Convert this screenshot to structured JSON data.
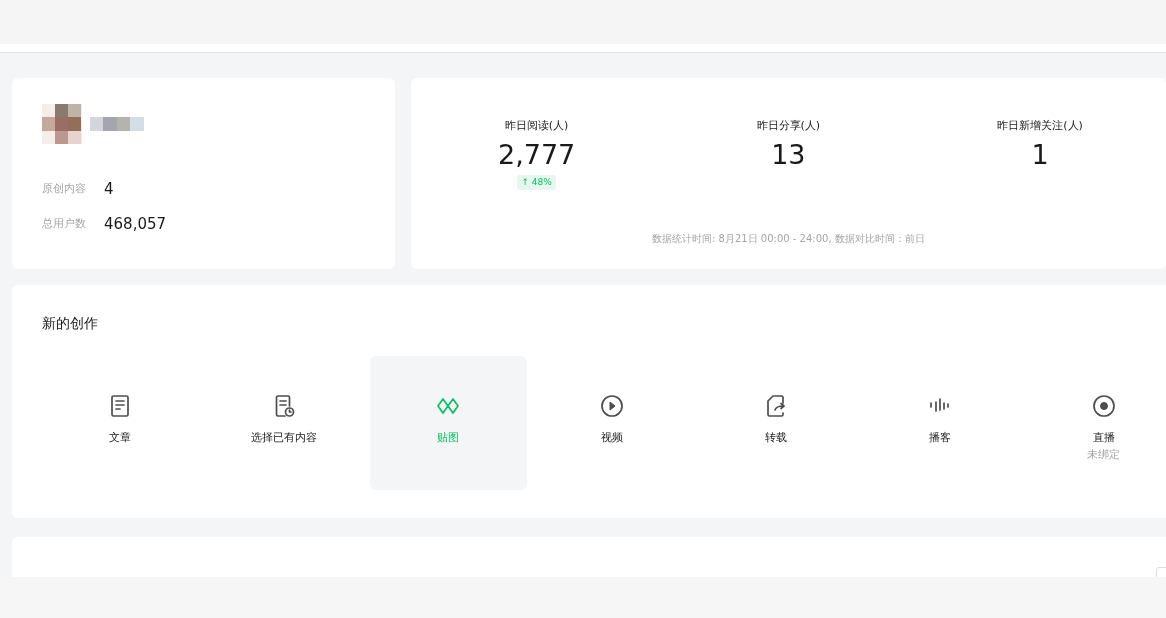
{
  "profile": {
    "stats": [
      {
        "label": "原创内容",
        "value": "4"
      },
      {
        "label": "总用户数",
        "value": "468,057"
      }
    ]
  },
  "metrics": {
    "items": [
      {
        "label": "昨日阅读(人)",
        "value": "2,777",
        "change": "↑ 48%"
      },
      {
        "label": "昨日分享(人)",
        "value": "13"
      },
      {
        "label": "昨日新增关注(人)",
        "value": "1"
      }
    ],
    "note": "数据统计时间: 8月21日 00:00 - 24:00, 数据对比时间：前日"
  },
  "create": {
    "title": "新的创作",
    "items": [
      {
        "kind": "article",
        "label": "文章",
        "selected": false
      },
      {
        "kind": "select",
        "label": "选择已有内容",
        "selected": false
      },
      {
        "kind": "sticker",
        "label": "贴图",
        "selected": true
      },
      {
        "kind": "video",
        "label": "视频",
        "selected": false
      },
      {
        "kind": "repost",
        "label": "转载",
        "selected": false
      },
      {
        "kind": "podcast",
        "label": "播客",
        "selected": false
      },
      {
        "kind": "live",
        "label": "直播",
        "sublabel": "未绑定",
        "selected": false
      }
    ]
  }
}
